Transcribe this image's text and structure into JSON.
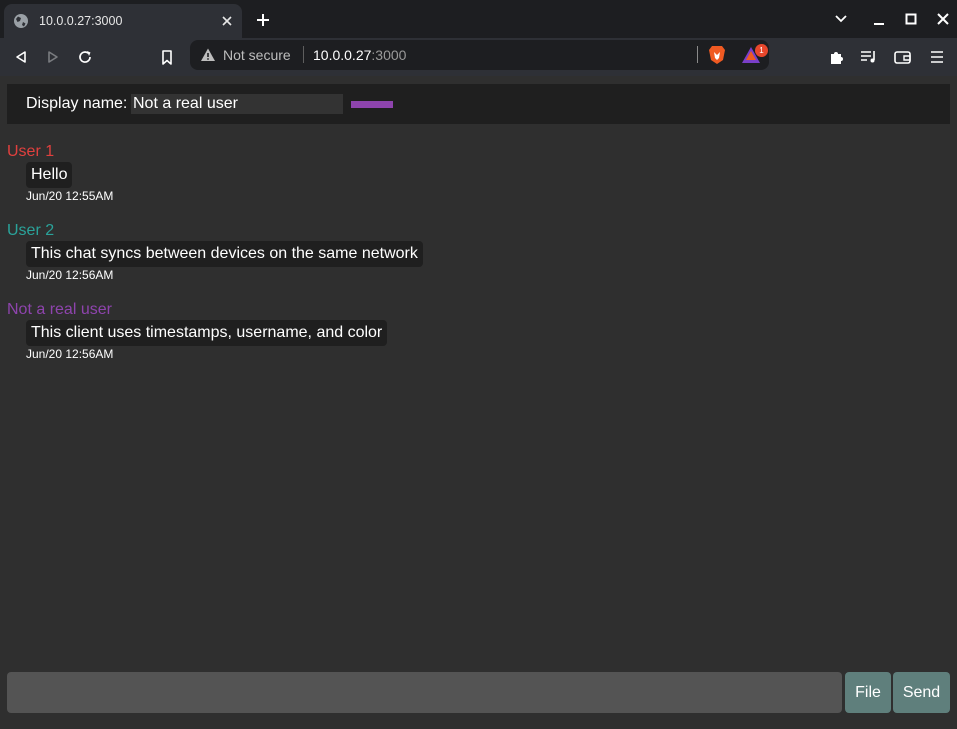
{
  "browser": {
    "tab_title": "10.0.0.27:3000",
    "security_label": "Not secure",
    "url_host": "10.0.0.27",
    "url_port": ":3000",
    "rewards_badge": "1"
  },
  "header": {
    "display_name_label": "Display name:",
    "display_name_value": "Not a real user",
    "user_color": "#8e44ad"
  },
  "messages": [
    {
      "user": "User 1",
      "color": "#e0403e",
      "text": "Hello",
      "timestamp": "Jun/20 12:55AM"
    },
    {
      "user": "User 2",
      "color": "#2aa39a",
      "text": "This chat syncs between devices on the same network",
      "timestamp": "Jun/20 12:56AM"
    },
    {
      "user": "Not a real user",
      "color": "#8e44ad",
      "text": "This client uses timestamps, username, and color",
      "timestamp": "Jun/20 12:56AM"
    }
  ],
  "composer": {
    "message_value": "",
    "file_label": "File",
    "send_label": "Send"
  }
}
